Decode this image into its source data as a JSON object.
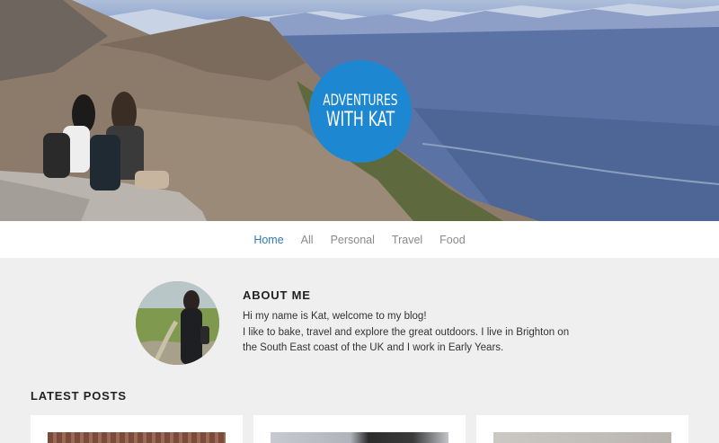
{
  "hero": {
    "logo_line1": "ADVENTURES",
    "logo_line2": "WITH KAT",
    "brand_color": "#1e87d1"
  },
  "nav": {
    "items": [
      {
        "label": "Home",
        "active": true
      },
      {
        "label": "All",
        "active": false
      },
      {
        "label": "Personal",
        "active": false
      },
      {
        "label": "Travel",
        "active": false
      },
      {
        "label": "Food",
        "active": false
      }
    ],
    "active_color": "#2f7ab7"
  },
  "about": {
    "title": "ABOUT ME",
    "line1": "Hi my name is Kat, welcome to my blog!",
    "line2": "I like to bake, travel and explore the great outdoors. I live in Brighton on the South East coast of the UK and I work in Early Years."
  },
  "latest_posts": {
    "title": "LATEST POSTS",
    "cards": [
      {
        "thumb_color": "#7a4a3a"
      },
      {
        "thumb_color": "#b9bcc4"
      },
      {
        "thumb_color": "#c4c1bc"
      }
    ]
  }
}
